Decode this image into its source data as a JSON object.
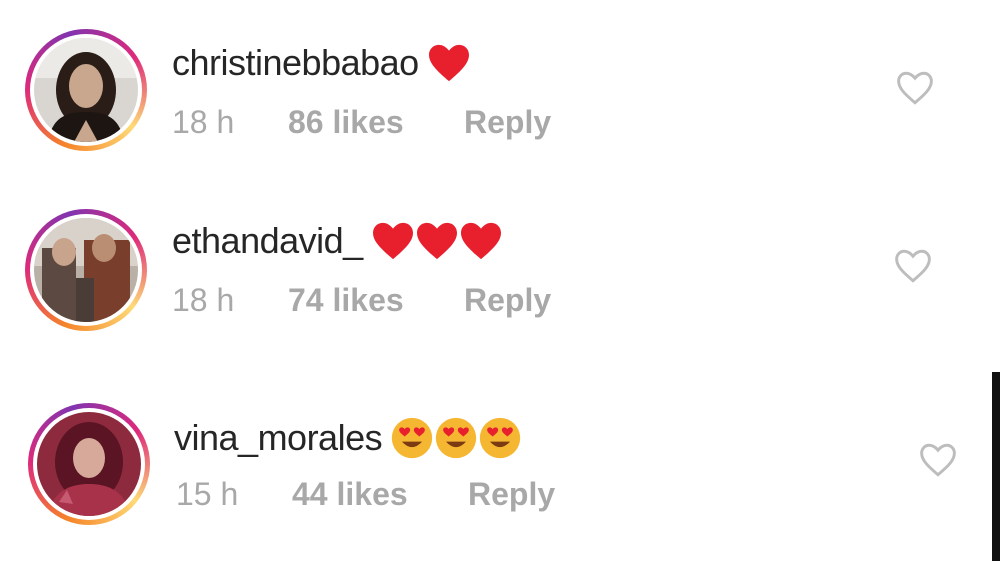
{
  "comments": [
    {
      "username": "christinebbabao",
      "emoji": "red-heart",
      "emoji_count": 1,
      "time": "18 h",
      "likes": "86 likes",
      "reply": "Reply",
      "like_icon": "heart-outline-icon"
    },
    {
      "username": "ethandavid_",
      "emoji": "red-heart",
      "emoji_count": 3,
      "time": "18 h",
      "likes": "74 likes",
      "reply": "Reply",
      "like_icon": "heart-outline-icon"
    },
    {
      "username": "vina_morales",
      "emoji": "heart-eyes-face",
      "emoji_count": 3,
      "time": "15 h",
      "likes": "44 likes",
      "reply": "Reply",
      "like_icon": "heart-outline-icon"
    }
  ],
  "colors": {
    "username": "#262626",
    "meta": "#a8a8a8",
    "heart_emoji": "#e8202e",
    "like_outline": "#bdbdbd"
  }
}
